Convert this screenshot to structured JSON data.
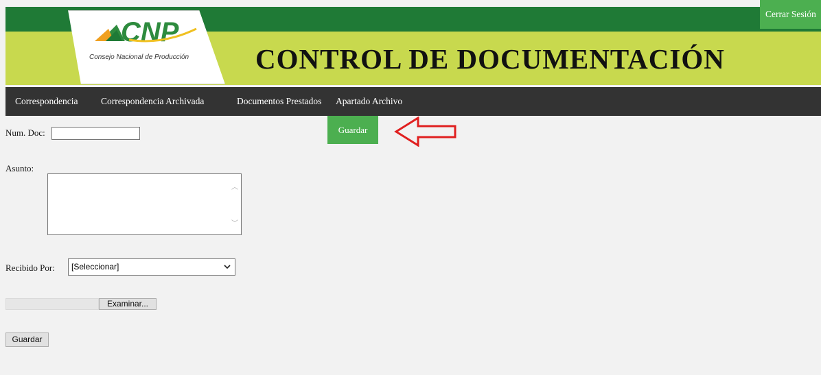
{
  "header": {
    "logo_text": "CNP",
    "logo_subtitle": "Consejo Nacional de Producción",
    "title": "CONTROL DE DOCUMENTACIÓN",
    "colors": {
      "dark_green": "#1f7a36",
      "lime": "#c8d94e"
    }
  },
  "nav": {
    "items": [
      {
        "label": "Correspondencia"
      },
      {
        "label": "Correspondencia Archivada"
      },
      {
        "label": "Documentos Prestados"
      },
      {
        "label": "Apartado Archivo"
      }
    ],
    "logout_label": "Cerrar Sesión",
    "colors": {
      "bar": "#333333",
      "accent": "#4caf50"
    }
  },
  "form": {
    "num_doc_label": "Num. Doc:",
    "num_doc_value": "",
    "asunto_label": "Asunto:",
    "asunto_value": "",
    "recibido_label": "Recibido Por:",
    "recibido_selected": "[Seleccionar]",
    "browse_label": "Examinar...",
    "save_label": "Guardar"
  },
  "top_save_label": "Guardar",
  "annotation": {
    "arrow_icon": "red-left-arrow-icon",
    "color": "#e02020"
  }
}
